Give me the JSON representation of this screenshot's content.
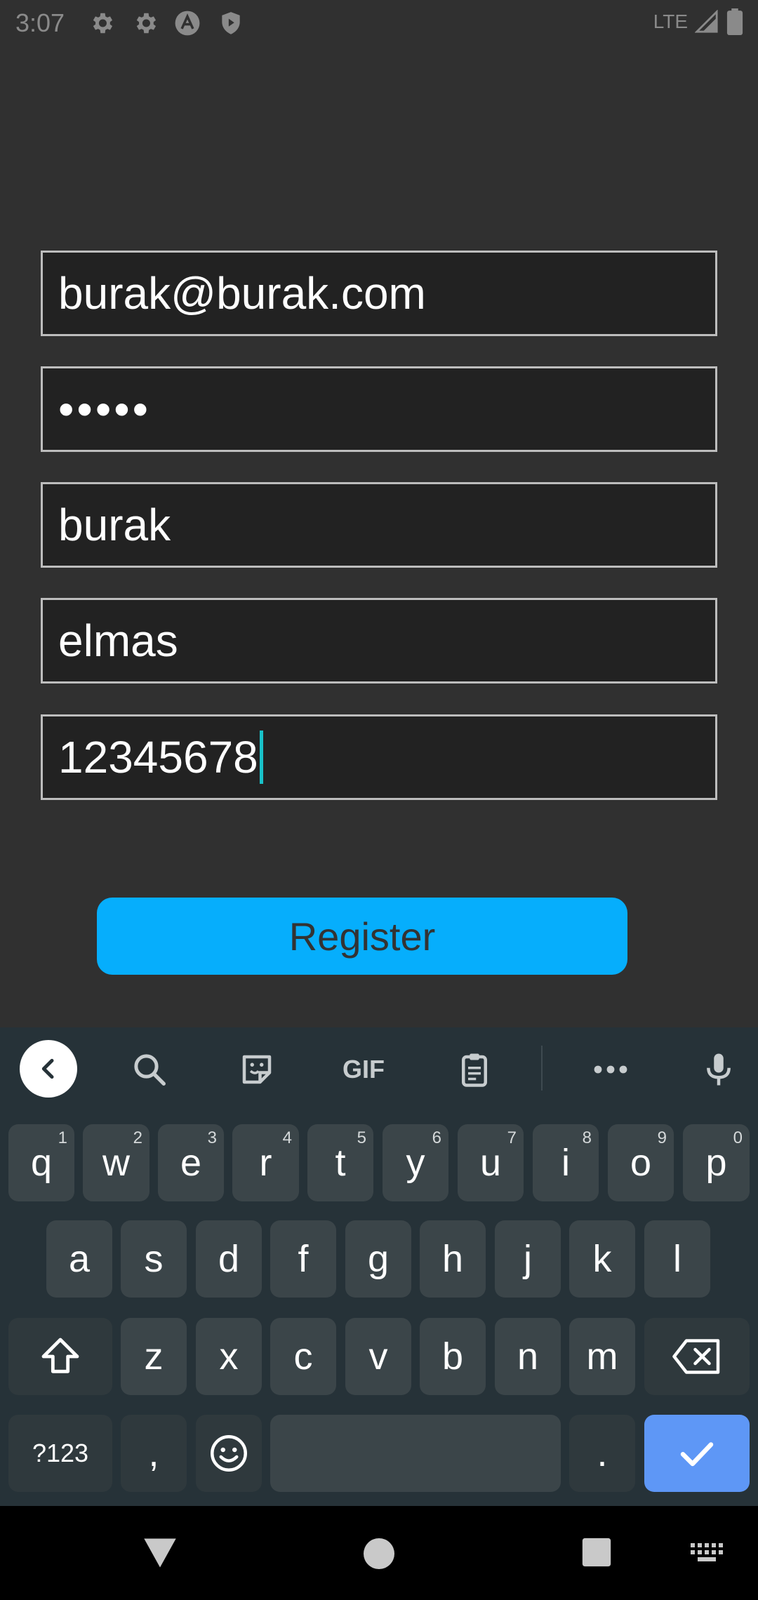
{
  "status_bar": {
    "time": "3:07",
    "icons": [
      "settings-icon",
      "settings-icon",
      "app-a-icon",
      "shield-icon"
    ],
    "network": "LTE"
  },
  "form": {
    "email_value": "burak@burak.com",
    "password_value": "•••••",
    "first_name_value": "burak",
    "last_name_value": "elmas",
    "phone_value": "12345678",
    "register_label": "Register"
  },
  "keyboard": {
    "toolbar": [
      "back-icon",
      "search-icon",
      "sticker-icon",
      "GIF",
      "clipboard-icon",
      "more-icon",
      "mic-icon"
    ],
    "row1": [
      {
        "k": "q",
        "h": "1"
      },
      {
        "k": "w",
        "h": "2"
      },
      {
        "k": "e",
        "h": "3"
      },
      {
        "k": "r",
        "h": "4"
      },
      {
        "k": "t",
        "h": "5"
      },
      {
        "k": "y",
        "h": "6"
      },
      {
        "k": "u",
        "h": "7"
      },
      {
        "k": "i",
        "h": "8"
      },
      {
        "k": "o",
        "h": "9"
      },
      {
        "k": "p",
        "h": "0"
      }
    ],
    "row2": [
      "a",
      "s",
      "d",
      "f",
      "g",
      "h",
      "j",
      "k",
      "l"
    ],
    "row3": [
      "z",
      "x",
      "c",
      "v",
      "b",
      "n",
      "m"
    ],
    "symbols_label": "?123",
    "comma": ",",
    "period": "."
  },
  "colors": {
    "accent": "#06aefc",
    "cursor": "#19c2c9",
    "enter_key": "#5e97f6",
    "keyboard_bg": "#263238"
  }
}
